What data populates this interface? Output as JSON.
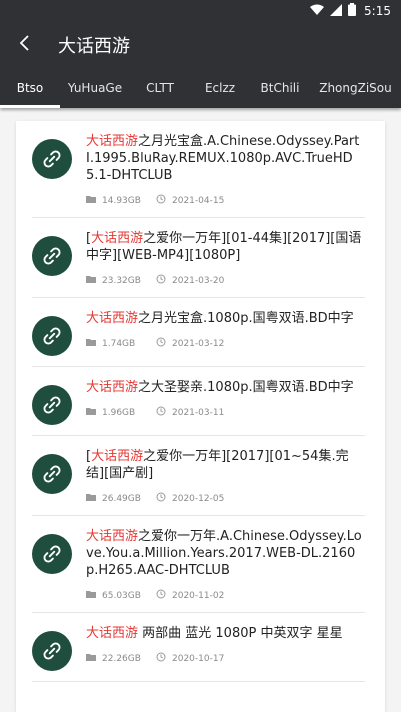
{
  "status": {
    "time": "5:15"
  },
  "appbar": {
    "title": "大话西游"
  },
  "tabs": [
    "Btso",
    "YuHuaGe",
    "CLTT",
    "Eclzz",
    "BtChili",
    "ZhongZiSou"
  ],
  "items": [
    {
      "highlight": "大话西游",
      "prefix": "",
      "rest": "之月光宝盒.A.Chinese.Odyssey.PartI.1995.BluRay.REMUX.1080p.AVC.TrueHD5.1-DHTCLUB",
      "size": "14.93GB",
      "date": "2021-04-15"
    },
    {
      "highlight": "大话西游",
      "prefix": "[",
      "rest": "之爱你一万年][01-44集][2017][国语中字][WEB-MP4][1080P]",
      "size": "23.32GB",
      "date": "2021-03-20"
    },
    {
      "highlight": "大话西游",
      "prefix": "",
      "rest": "之月光宝盒.1080p.国粤双语.BD中字",
      "size": "1.74GB",
      "date": "2021-03-12"
    },
    {
      "highlight": "大话西游",
      "prefix": "",
      "rest": "之大圣娶亲.1080p.国粤双语.BD中字",
      "size": "1.96GB",
      "date": "2021-03-11"
    },
    {
      "highlight": "大话西游",
      "prefix": "[",
      "rest": "之爱你一万年][2017][01~54集.完结][国产剧]",
      "size": "26.49GB",
      "date": "2020-12-05"
    },
    {
      "highlight": "大话西游",
      "prefix": "",
      "rest": "之爱你一万年.A.Chinese.Odyssey.Love.You.a.Million.Years.2017.WEB-DL.2160p.H265.AAC-DHTCLUB",
      "size": "65.03GB",
      "date": "2020-11-02"
    },
    {
      "highlight": "大话西游",
      "prefix": "",
      "rest": " 两部曲 蓝光 1080P 中英双字 星星",
      "size": "22.26GB",
      "date": "2020-10-17"
    }
  ]
}
